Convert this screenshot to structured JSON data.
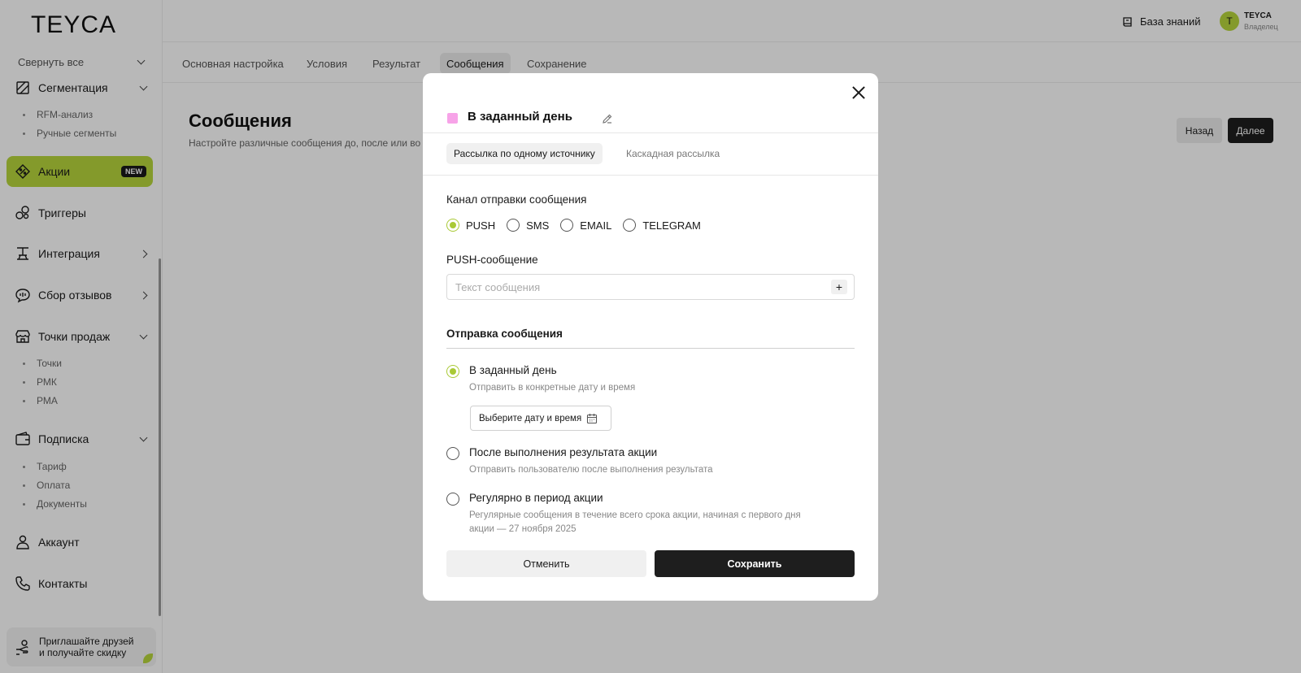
{
  "app": {
    "logo": "TEYCA"
  },
  "sidebar": {
    "collapse_all": "Свернуть все",
    "segmentation": {
      "label": "Сегментация",
      "subitems": [
        "RFM-анализ",
        "Ручные сегменты"
      ]
    },
    "promotions": {
      "label": "Акции",
      "badge": "NEW"
    },
    "triggers": {
      "label": "Триггеры"
    },
    "integration": {
      "label": "Интеграция"
    },
    "feedback": {
      "label": "Сбор отзывов"
    },
    "points": {
      "label": "Точки продаж",
      "subitems": [
        "Точки",
        "РМК",
        "РМА"
      ]
    },
    "subscription": {
      "label": "Подписка",
      "subitems": [
        "Тариф",
        "Оплата",
        "Документы"
      ]
    },
    "account": {
      "label": "Аккаунт"
    },
    "contacts": {
      "label": "Контакты"
    },
    "invite": {
      "line1": "Приглашайте друзей",
      "line2": "и получайте скидку"
    }
  },
  "header": {
    "knowledge_base": "База знаний",
    "user": {
      "initial": "T",
      "name": "TEYCA",
      "role": "Владелец"
    }
  },
  "tabs": [
    "Основная настройка",
    "Условия",
    "Результат",
    "Сообщения",
    "Сохранение"
  ],
  "page": {
    "title": "Сообщения",
    "subtitle": "Настройте различные сообщения до, после или во",
    "back": "Назад",
    "next": "Далее"
  },
  "modal": {
    "title": "В заданный день",
    "accent_color": "#f7a3e8",
    "tabs": [
      "Рассылка по одному источнику",
      "Каскадная рассылка"
    ],
    "channel_label": "Канал отправки сообщения",
    "channels": [
      "PUSH",
      "SMS",
      "EMAIL",
      "TELEGRAM"
    ],
    "selected_channel": "PUSH",
    "push_label": "PUSH-сообщение",
    "push_placeholder": "Текст сообщения",
    "push_value": "",
    "send_section": "Отправка сообщения",
    "options": [
      {
        "title": "В заданный день",
        "desc": "Отправить в конкретные дату и время",
        "selected": true
      },
      {
        "title": "После выполнения результата акции",
        "desc": "Отправить пользователю после выполнения результата",
        "selected": false
      },
      {
        "title": "Регулярно в период акции",
        "desc": "Регулярные сообщения в течение всего срока акции, начиная с первого дня акции — 27 ноября 2025",
        "selected": false
      }
    ],
    "date_picker": "Выберите дату и время",
    "cancel": "Отменить",
    "save": "Сохранить"
  }
}
